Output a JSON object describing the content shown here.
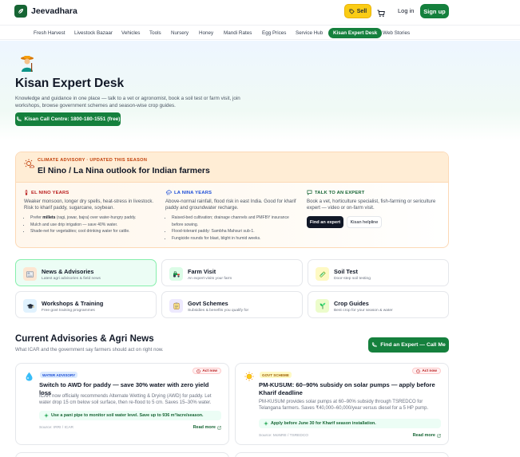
{
  "brand": {
    "name": "Jeevadhara"
  },
  "header": {
    "sell_label": "Sell",
    "login_label": "Log in",
    "signup_label": "Sign up"
  },
  "nav": {
    "items": [
      "Fresh Harvest",
      "Livestock Bazaar",
      "Vehicles",
      "Tools",
      "Nursery",
      "Honey",
      "Mandi Rates",
      "Egg Prices",
      "Service Hub",
      "Kisan Expert Desk",
      "Web Stories"
    ],
    "active": "Kisan Expert Desk"
  },
  "hero": {
    "title": "Kisan Expert Desk",
    "description": "Knowledge and guidance in one place — talk to a vet or agronomist, book a soil test or farm visit, join workshops, browse government schemes and season-wise crop guides.",
    "call_button": "Kisan Call Centre: 1800-180-1551 (free)"
  },
  "climate": {
    "kicker": "CLIMATE ADVISORY · UPDATED THIS SEASON",
    "title": "El Nino / La Nina outlook for Indian farmers",
    "el_nino": {
      "heading": "EL NINO YEARS",
      "summary": "Weaker monsoon, longer dry spells, heat-stress in livestock. Risk to kharif paddy, sugarcane, soybean.",
      "bullets": [
        {
          "before": "Prefer ",
          "bold": "millets",
          "after": " (ragi, jowar, bajra) over water-hungry paddy."
        },
        {
          "before": "Mulch and use drip irrigation — save 40% water.",
          "bold": "",
          "after": ""
        },
        {
          "before": "Shade-net for vegetables; cool drinking water for cattle.",
          "bold": "",
          "after": ""
        }
      ]
    },
    "la_nina": {
      "heading": "LA NINA YEARS",
      "summary": "Above-normal rainfall, flood risk in east India. Good for kharif paddy and groundwater recharge.",
      "bullets": [
        "Raised-bed cultivation; drainage channels and PMFBY insurance before sowing.",
        "Flood-tolerant paddy: Sambha Mahsuri sub-1.",
        "Fungicide rounds for blast, blight in humid weeks."
      ]
    },
    "talk": {
      "heading": "TALK TO AN EXPERT",
      "summary": "Book a vet, horticulture specialist, fish-farming or sericulture expert — video or on-farm visit.",
      "find_button": "Find an expert",
      "helpline_button": "Kisan helpline"
    }
  },
  "services": [
    {
      "title": "News & Advisories",
      "subtitle": "Latest agri advisories & field news",
      "icon": "newspaper-icon"
    },
    {
      "title": "Farm Visit",
      "subtitle": "An expert visits your farm",
      "icon": "tractor-icon"
    },
    {
      "title": "Soil Test",
      "subtitle": "Door-step soil testing",
      "icon": "test-tube-icon"
    },
    {
      "title": "Workshops & Training",
      "subtitle": "Free govt training programmes",
      "icon": "graduation-cap-icon"
    },
    {
      "title": "Govt Schemes",
      "subtitle": "Subsidies & benefits you qualify for",
      "icon": "clipboard-icon"
    },
    {
      "title": "Crop Guides",
      "subtitle": "Best crop for your season & water",
      "icon": "seedling-icon"
    }
  ],
  "advisories": {
    "title": "Current Advisories & Agri News",
    "subtitle": "What ICAR and the government say farmers should act on right now.",
    "cta": "Find an Expert — Call Me",
    "items": [
      {
        "tag": "WATER ADVISORY",
        "act_now": "Act now",
        "title": "Switch to AWD for paddy — save 30% water with zero yield loss",
        "body": "ICAR now officially recommends Alternate Wetting & Drying (AWD) for paddy. Let water drop 15 cm below soil surface, then re-flood to 5 cm. Saves 15–30% water.",
        "tip": "Use a pani pipe to monitor soil water level. Save up to 936 m³/acre/season.",
        "source": "Source: IRRI / ICAR",
        "read_more": "Read more"
      },
      {
        "tag": "GOVT SCHEME",
        "act_now": "Act now",
        "title": "PM-KUSUM: 60–90% subsidy on solar pumps — apply before Kharif deadline",
        "body": "PM-KUSUM provides solar pumps at 60–90% subsidy through TSREDCO for Telangana farmers. Saves ₹40,000–60,000/year versus diesel for a 5 HP pump.",
        "tip": "Apply before June 30 for Kharif season installation.",
        "source": "Source: MoNRE / TSREDCO",
        "read_more": "Read more"
      }
    ]
  },
  "colors": {
    "brand_green": "#15803d",
    "sell_yellow": "#facc15",
    "el_nino_red": "#b91c1c",
    "la_nina_blue": "#1d4ed8",
    "expert_green": "#166534"
  }
}
